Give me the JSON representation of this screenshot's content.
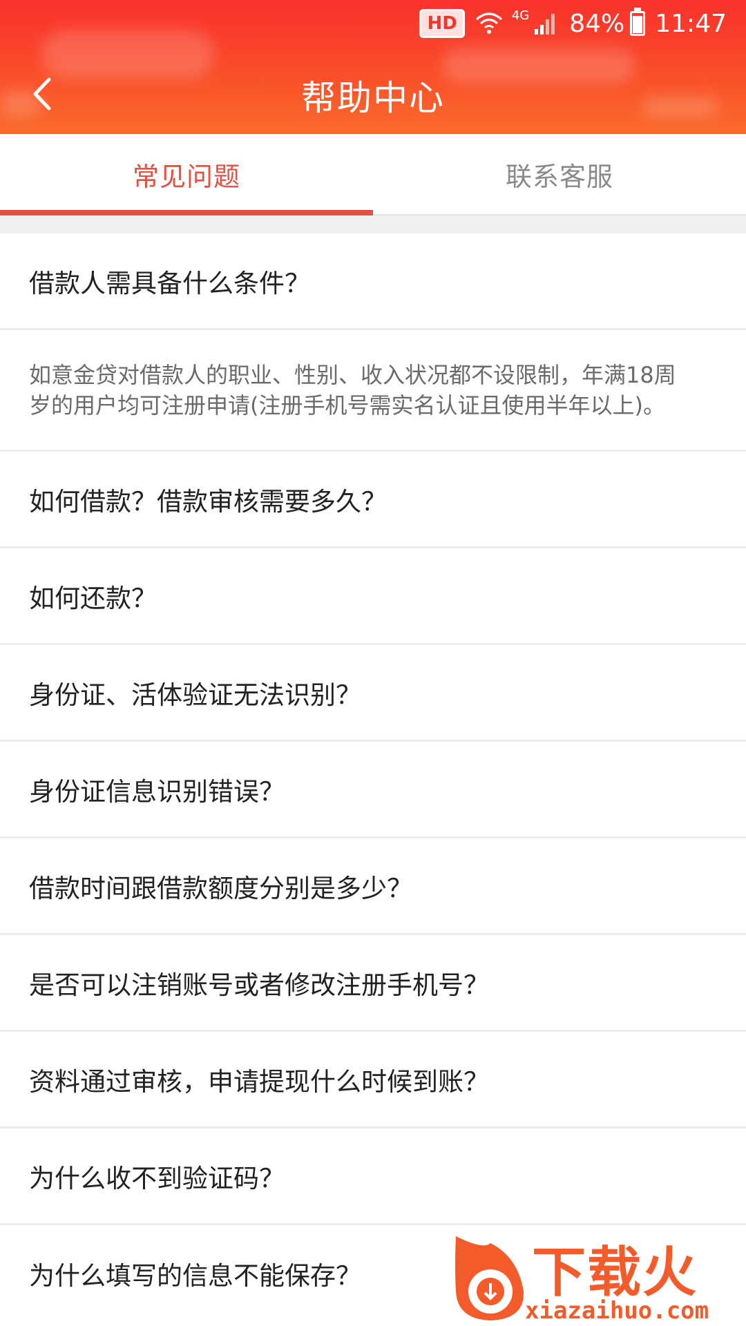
{
  "status_bar": {
    "hd": "HD",
    "network": "4G",
    "battery": "84%",
    "time": "11:47"
  },
  "header": {
    "title": "帮助中心",
    "back_icon": "chevron-left-icon",
    "color": "#f9322c"
  },
  "tabs": [
    {
      "label": "常见问题",
      "active": true
    },
    {
      "label": "联系客服",
      "active": false
    }
  ],
  "accent_color": "#e25142",
  "faq": {
    "q1": "借款人需具备什么条件？",
    "a1_line1": "如意金贷对借款人的职业、性别、收入状况都不设限制，年满18周",
    "a1_line2": "岁的用户均可注册申请(注册手机号需实名认证且使用半年以上)。",
    "items": [
      "如何借款？借款审核需要多久？",
      "如何还款？",
      "身份证、活体验证无法识别？",
      "身份证信息识别错误？",
      "借款时间跟借款额度分别是多少？",
      "是否可以注销账号或者修改注册手机号？",
      "资料通过审核，申请提现什么时候到账？",
      "为什么收不到验证码？",
      "为什么填写的信息不能保存？"
    ]
  },
  "watermark": {
    "name": "下载火",
    "url": "xiazaihuo.com"
  }
}
